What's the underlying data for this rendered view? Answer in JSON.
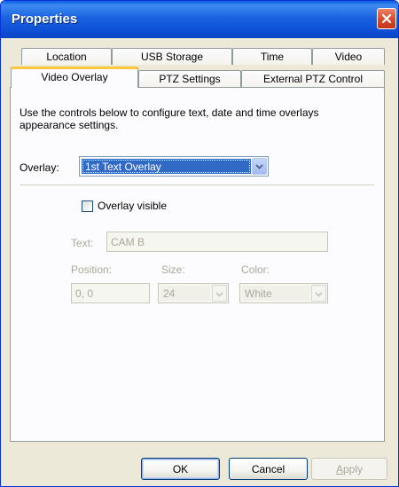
{
  "window": {
    "title": "Properties"
  },
  "tabs_back": [
    {
      "label": "Location"
    },
    {
      "label": "USB Storage"
    },
    {
      "label": "Time"
    },
    {
      "label": "Video"
    }
  ],
  "tabs_front": [
    {
      "label": "Video Overlay",
      "active": true
    },
    {
      "label": "PTZ Settings"
    },
    {
      "label": "External PTZ Control"
    }
  ],
  "panel": {
    "description": "Use the controls below to configure text, date and time overlays appearance settings.",
    "overlay_label": "Overlay:",
    "overlay_value": "1st Text Overlay",
    "overlay_visible_label": "Overlay visible",
    "overlay_visible_checked": false,
    "text_label": "Text:",
    "text_value": "CAM B",
    "position_label": "Position:",
    "position_value": "0, 0",
    "size_label": "Size:",
    "size_value": "24",
    "color_label": "Color:",
    "color_value": "White"
  },
  "buttons": {
    "ok": "OK",
    "cancel": "Cancel",
    "apply_mnemonic": "A",
    "apply_rest": "pply"
  },
  "icons": {
    "close": "close-icon",
    "dropdown": "chevron-down-icon"
  },
  "colors": {
    "titlebar": "#0a5ddf",
    "selection": "#316ac5",
    "active_tab_accent": "#ffc83c",
    "close_button": "#d8492a"
  }
}
